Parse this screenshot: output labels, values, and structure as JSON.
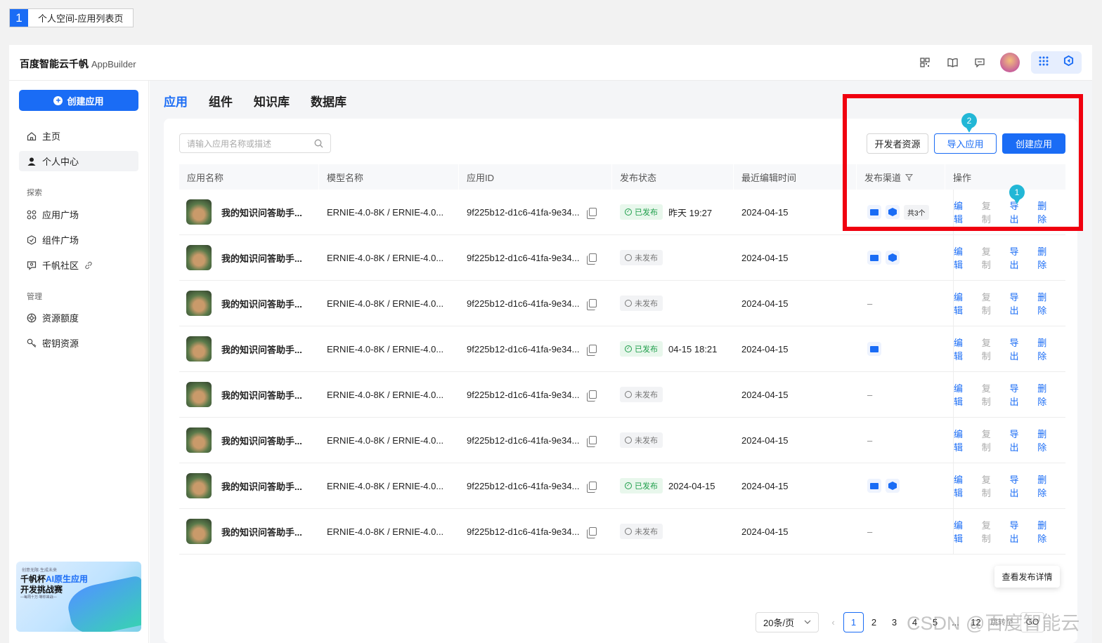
{
  "page_tag": {
    "number": "1",
    "label": "个人空间-应用列表页"
  },
  "brand": {
    "name": "百度智能云千帆",
    "product": "AppBuilder"
  },
  "topbar_icons": [
    "qr-grid-icon",
    "book-icon",
    "feedback-icon",
    "avatar",
    "apps-grid-icon",
    "qianfan-logo-icon"
  ],
  "sidebar": {
    "create_label": "创建应用",
    "items": [
      {
        "label": "主页",
        "icon": "home-icon"
      },
      {
        "label": "个人中心",
        "icon": "user-icon",
        "active": true
      }
    ],
    "section_explore": "探索",
    "explore_items": [
      {
        "label": "应用广场",
        "icon": "app-square-icon"
      },
      {
        "label": "组件广场",
        "icon": "component-icon"
      },
      {
        "label": "千帆社区",
        "icon": "community-icon"
      }
    ],
    "section_manage": "管理",
    "manage_items": [
      {
        "label": "资源额度",
        "icon": "quota-icon"
      },
      {
        "label": "密钥资源",
        "icon": "key-icon"
      }
    ],
    "promo": {
      "small": "创意无限·生成未来",
      "line1a": "千帆杯",
      "line1b": "AI原生应用",
      "line2": "开发挑战赛",
      "line3": "—每周十万·等你来战—"
    }
  },
  "tabs": [
    "应用",
    "组件",
    "知识库",
    "数据库"
  ],
  "search_placeholder": "请输入应用名称或描述",
  "buttons": {
    "dev_resources": "开发者资源",
    "import_app": "导入应用",
    "create_app": "创建应用"
  },
  "columns": [
    "应用名称",
    "模型名称",
    "应用ID",
    "发布状态",
    "最近编辑时间",
    "发布渠道",
    "操作"
  ],
  "rows": [
    {
      "name": "我的知识问答助手...",
      "model": "ERNIE-4.0-8K / ERNIE-4.0...",
      "id": "9f225b12-d1c6-41fa-9e34...",
      "status": "已发布",
      "published": true,
      "pub_time": "昨天 19:27",
      "edited": "2024-04-15",
      "channels": [
        "monitor",
        "hex"
      ],
      "channel_count": "共3个"
    },
    {
      "name": "我的知识问答助手...",
      "model": "ERNIE-4.0-8K / ERNIE-4.0...",
      "id": "9f225b12-d1c6-41fa-9e34...",
      "status": "未发布",
      "published": false,
      "pub_time": "",
      "edited": "2024-04-15",
      "channels": [
        "monitor",
        "hex"
      ],
      "channel_count": ""
    },
    {
      "name": "我的知识问答助手...",
      "model": "ERNIE-4.0-8K / ERNIE-4.0...",
      "id": "9f225b12-d1c6-41fa-9e34...",
      "status": "未发布",
      "published": false,
      "pub_time": "",
      "edited": "2024-04-15",
      "channels": [],
      "channel_count": ""
    },
    {
      "name": "我的知识问答助手...",
      "model": "ERNIE-4.0-8K / ERNIE-4.0...",
      "id": "9f225b12-d1c6-41fa-9e34...",
      "status": "已发布",
      "published": true,
      "pub_time": "04-15 18:21",
      "edited": "2024-04-15",
      "channels": [
        "monitor"
      ],
      "channel_count": ""
    },
    {
      "name": "我的知识问答助手...",
      "model": "ERNIE-4.0-8K / ERNIE-4.0...",
      "id": "9f225b12-d1c6-41fa-9e34...",
      "status": "未发布",
      "published": false,
      "pub_time": "",
      "edited": "2024-04-15",
      "channels": [],
      "channel_count": ""
    },
    {
      "name": "我的知识问答助手...",
      "model": "ERNIE-4.0-8K / ERNIE-4.0...",
      "id": "9f225b12-d1c6-41fa-9e34...",
      "status": "未发布",
      "published": false,
      "pub_time": "",
      "edited": "2024-04-15",
      "channels": [],
      "channel_count": ""
    },
    {
      "name": "我的知识问答助手...",
      "model": "ERNIE-4.0-8K / ERNIE-4.0...",
      "id": "9f225b12-d1c6-41fa-9e34...",
      "status": "已发布",
      "published": true,
      "pub_time": "2024-04-15",
      "edited": "2024-04-15",
      "channels": [
        "monitor",
        "hex"
      ],
      "channel_count": ""
    },
    {
      "name": "我的知识问答助手...",
      "model": "ERNIE-4.0-8K / ERNIE-4.0...",
      "id": "9f225b12-d1c6-41fa-9e34...",
      "status": "未发布",
      "published": false,
      "pub_time": "",
      "edited": "2024-04-15",
      "channels": [],
      "channel_count": ""
    }
  ],
  "empty_channel": "–",
  "actions": {
    "edit": "编辑",
    "copy": "复制",
    "export": "导出",
    "delete": "删除"
  },
  "tooltip": "查看发布详情",
  "pagination": {
    "page_size": "20条/页",
    "pages": [
      "1",
      "2",
      "3",
      "4",
      "5",
      "...",
      "12"
    ],
    "current": "1",
    "jump_label": "跳转至",
    "go": "GO"
  },
  "annotations": {
    "marker1": "1",
    "marker2": "2"
  },
  "watermark": "CSDN @百度智能云",
  "colors": {
    "accent": "#1a6cf5",
    "published": "#1e9e4a",
    "highlight_box": "#f0000f",
    "marker": "#22b7d6"
  }
}
